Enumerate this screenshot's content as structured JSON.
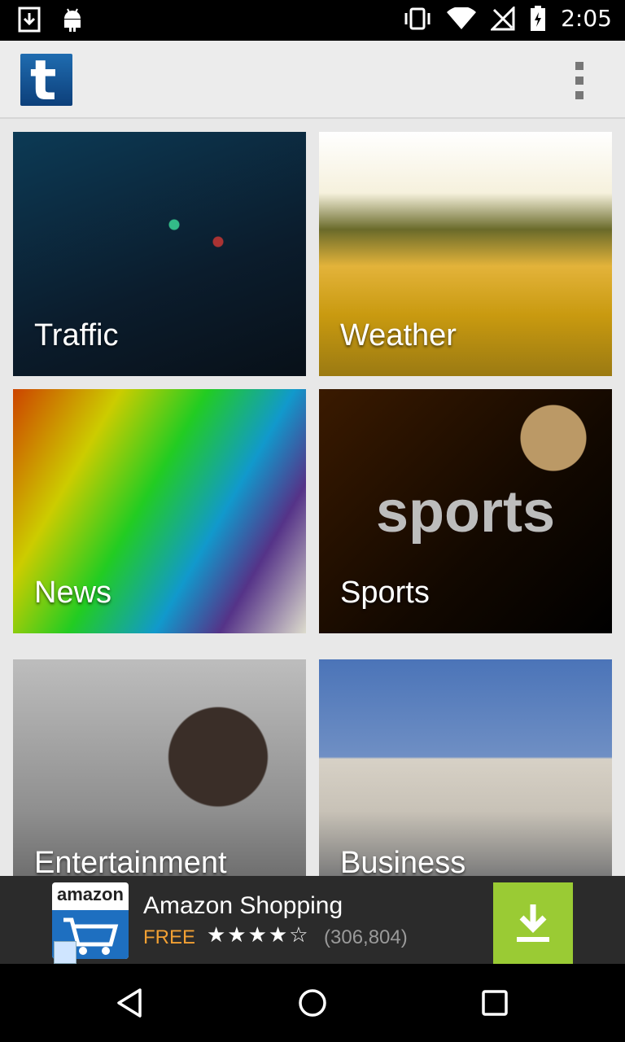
{
  "status_bar": {
    "time": "2:05",
    "icons": [
      "download-icon",
      "android-icon",
      "vibrate-icon",
      "wifi-icon",
      "no-signal-icon",
      "battery-charging-icon"
    ]
  },
  "action_bar": {
    "logo_letter": "t",
    "overflow_icon": "overflow-menu-icon"
  },
  "tiles": [
    {
      "label": "Traffic"
    },
    {
      "label": "Weather"
    },
    {
      "label": "News"
    },
    {
      "label": "Sports",
      "image_word": "sports"
    },
    {
      "label": "Entertainment"
    },
    {
      "label": "Business"
    }
  ],
  "ad": {
    "brand": "amazon",
    "title": "Amazon Shopping",
    "price": "FREE",
    "stars": "★★★★☆",
    "rating_count": "(306,804)",
    "download_icon": "download-icon"
  },
  "nav": {
    "back_icon": "back-icon",
    "home_icon": "home-icon",
    "recents_icon": "recents-icon"
  }
}
